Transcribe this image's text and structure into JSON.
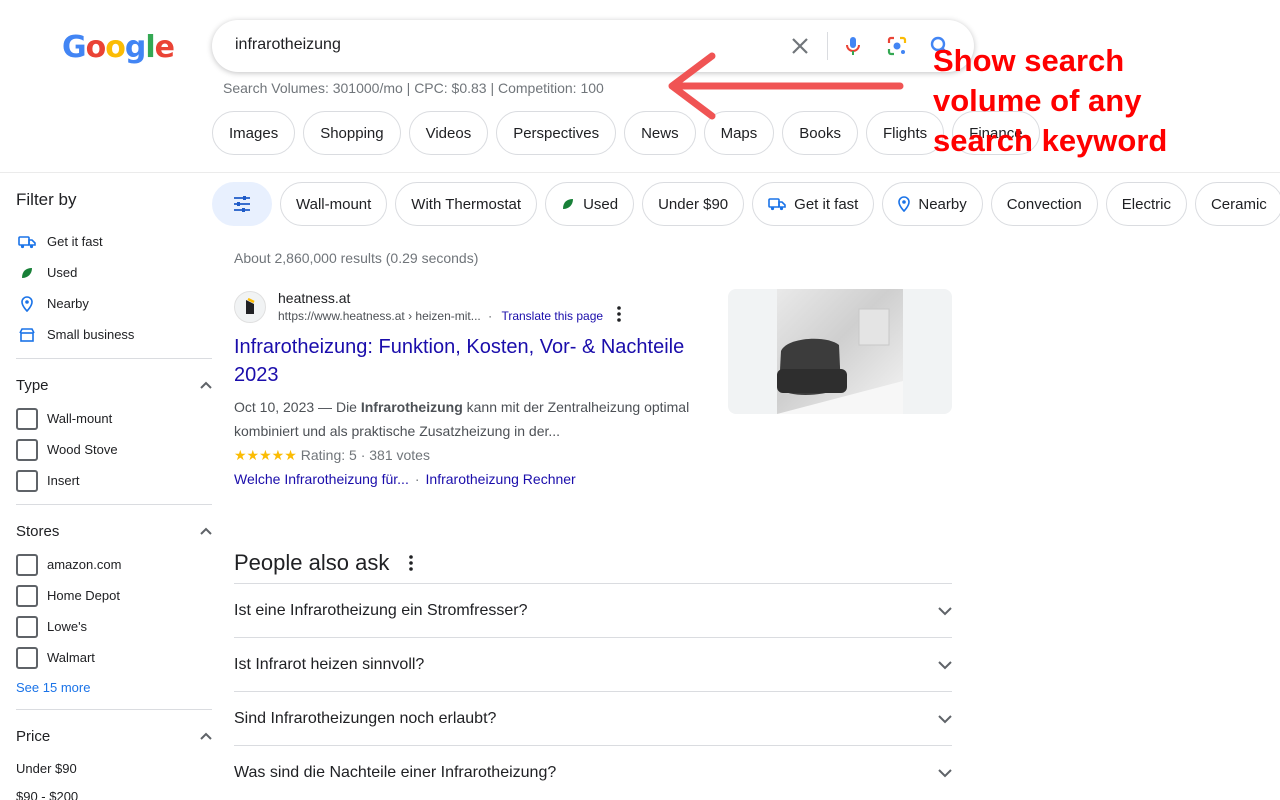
{
  "logo": {
    "text": "Google"
  },
  "search": {
    "query": "infrarotheizung"
  },
  "volume_text": "Search Volumes: 301000/mo | CPC: $0.83 | Competition: 100",
  "tabs": [
    "Images",
    "Shopping",
    "Videos",
    "Perspectives",
    "News",
    "Maps",
    "Books",
    "Flights",
    "Finance"
  ],
  "annotation": {
    "line1": "Show search",
    "line2": "volume of any",
    "line3": "search keyword",
    "color": "#ff0000"
  },
  "sidebar": {
    "title": "Filter by",
    "quick": [
      "Get it fast",
      "Used",
      "Nearby",
      "Small business"
    ],
    "type_label": "Type",
    "types": [
      "Wall-mount",
      "Wood Stove",
      "Insert"
    ],
    "stores_label": "Stores",
    "stores": [
      "amazon.com",
      "Home Depot",
      "Lowe's",
      "Walmart"
    ],
    "see_more": "See 15 more",
    "price_label": "Price",
    "prices": [
      "Under $90",
      "$90 - $200"
    ]
  },
  "chips": [
    "Wall-mount",
    "With Thermostat",
    "Used",
    "Under $90",
    "Get it fast",
    "Nearby",
    "Convection",
    "Electric",
    "Ceramic"
  ],
  "stats": "About 2,860,000 results (0.29 seconds)",
  "result": {
    "site": "heatness.at",
    "url": "https://www.heatness.at › heizen-mit...",
    "url_sep": "·",
    "translate": "Translate this page",
    "title": "Infrarotheizung: Funktion, Kosten, Vor- & Nachteile 2023",
    "date": "Oct 10, 2023 —",
    "snippet_pre": "Die",
    "snippet_bold": "Infrarotheizung",
    "snippet_post": "kann mit der Zentralheizung optimal kombiniert und als praktische Zusatzheizung in der...",
    "stars": "★★★★★",
    "rating": "Rating: 5 · 381 votes",
    "sitelink1": "Welche Infrarotheizung für...",
    "sitelink_sep": "·",
    "sitelink2": "Infrarotheizung Rechner"
  },
  "paa": {
    "title": "People also ask",
    "questions": [
      "Ist eine Infrarotheizung ein Stromfresser?",
      "Ist Infrarot heizen sinnvoll?",
      "Sind Infrarotheizungen noch erlaubt?",
      "Was sind die Nachteile einer Infrarotheizung?"
    ]
  },
  "colors": {
    "link": "#1a0dab",
    "accent_blue": "#1a73e8",
    "star": "#fbbc04"
  }
}
